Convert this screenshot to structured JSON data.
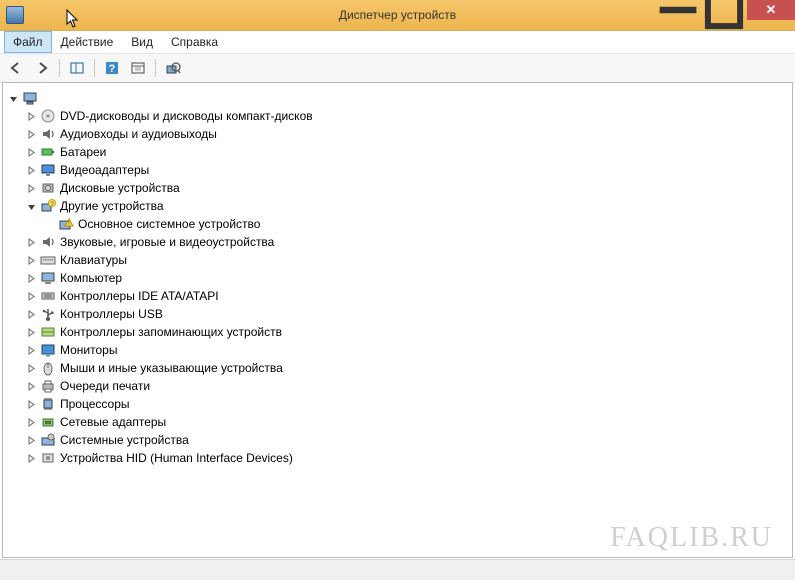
{
  "window": {
    "title": "Диспетчер устройств"
  },
  "menu": {
    "file": "Файл",
    "action": "Действие",
    "view": "Вид",
    "help": "Справка"
  },
  "root_label": "",
  "tree": [
    {
      "icon": "disc",
      "label": "DVD-дисководы и дисководы компакт-дисков"
    },
    {
      "icon": "audio",
      "label": "Аудиовходы и аудиовыходы"
    },
    {
      "icon": "battery",
      "label": "Батареи"
    },
    {
      "icon": "display",
      "label": "Видеоадаптеры"
    },
    {
      "icon": "disk",
      "label": "Дисковые устройства"
    },
    {
      "icon": "other",
      "label": "Другие устройства",
      "expanded": true,
      "children": [
        {
          "icon": "warn",
          "label": "Основное системное устройство"
        }
      ]
    },
    {
      "icon": "audio",
      "label": "Звуковые, игровые и видеоустройства"
    },
    {
      "icon": "keyboard",
      "label": "Клавиатуры"
    },
    {
      "icon": "computer",
      "label": "Компьютер"
    },
    {
      "icon": "ide",
      "label": "Контроллеры IDE ATA/ATAPI"
    },
    {
      "icon": "usb",
      "label": "Контроллеры USB"
    },
    {
      "icon": "storage",
      "label": "Контроллеры запоминающих устройств"
    },
    {
      "icon": "monitor",
      "label": "Мониторы"
    },
    {
      "icon": "mouse",
      "label": "Мыши и иные указывающие устройства"
    },
    {
      "icon": "printer",
      "label": "Очереди печати"
    },
    {
      "icon": "cpu",
      "label": "Процессоры"
    },
    {
      "icon": "network",
      "label": "Сетевые адаптеры"
    },
    {
      "icon": "system",
      "label": "Системные устройства"
    },
    {
      "icon": "hid",
      "label": "Устройства HID (Human Interface Devices)"
    }
  ],
  "watermark": "FAQLIB.RU"
}
